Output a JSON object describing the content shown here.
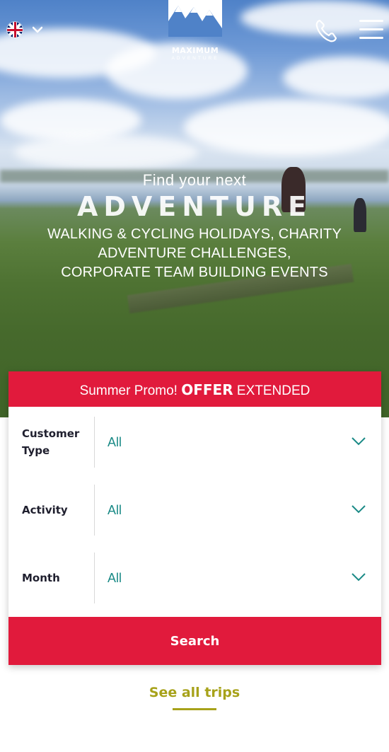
{
  "header": {
    "language_flag": "uk-flag-icon",
    "logo_name": "MAXIMUM",
    "logo_sub": "ADVENTURE",
    "phone_icon": "phone-icon",
    "menu_icon": "hamburger-menu-icon"
  },
  "hero": {
    "kicker": "Find your next",
    "headline": "ADVENTURE",
    "lines": [
      "WALKING & CYCLING HOLIDAYS, CHARITY",
      "ADVENTURE CHALLENGES,",
      "CORPORATE TEAM BUILDING EVENTS"
    ]
  },
  "promo": {
    "prefix": "Summer Promo!",
    "highlight": "OFFER",
    "suffix": "EXTENDED"
  },
  "filters": [
    {
      "label": "Customer Type",
      "value": "All"
    },
    {
      "label": "Activity",
      "value": "All"
    },
    {
      "label": "Month",
      "value": "All"
    }
  ],
  "search_label": "Search",
  "see_all_label": "See all trips",
  "colors": {
    "accent_red": "#e11a3c",
    "teal_value": "#1a8a86",
    "olive_link": "#a7a21a"
  }
}
